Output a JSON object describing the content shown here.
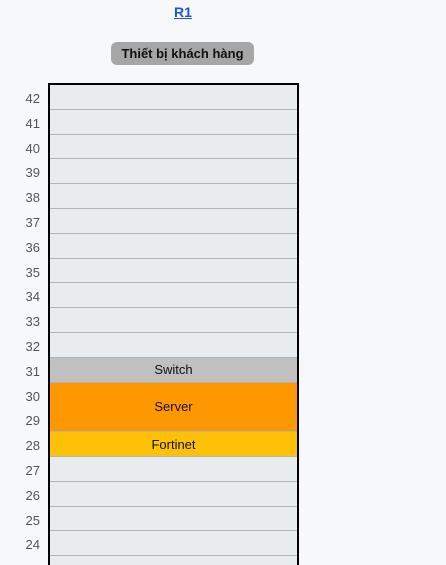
{
  "rack": {
    "name": "R1"
  },
  "badge": {
    "label": "Thiết bị khách hàng"
  },
  "units": [
    42,
    41,
    40,
    39,
    38,
    37,
    36,
    35,
    34,
    33,
    32,
    31,
    30,
    29,
    28,
    27,
    26,
    25,
    24
  ],
  "devices": [
    {
      "name": "Switch",
      "top_unit": 31,
      "size": 1,
      "color": "#c0c0c0"
    },
    {
      "name": "Server",
      "top_unit": 30,
      "size": 2,
      "color": "#ff9800"
    },
    {
      "name": "Fortinet",
      "top_unit": 28,
      "size": 1,
      "color": "#ffc107"
    }
  ]
}
